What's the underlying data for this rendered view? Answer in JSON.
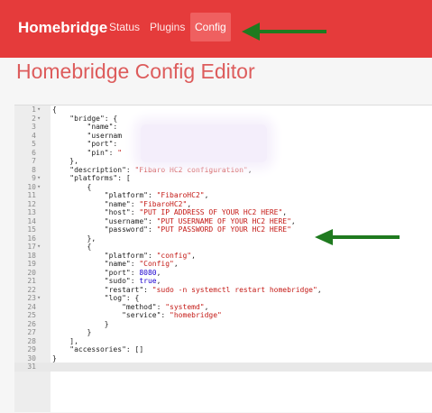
{
  "nav": {
    "brand": "Homebridge",
    "links": [
      "Status",
      "Plugins",
      "Config"
    ],
    "active": "Config"
  },
  "page": {
    "title": "Homebridge Config Editor"
  },
  "editor": {
    "lines": [
      {
        "n": "1",
        "fold": "▾",
        "t": [
          [
            "k",
            "{"
          ]
        ]
      },
      {
        "n": "2",
        "fold": "▾",
        "t": [
          [
            "k",
            "    \"bridge\": {"
          ]
        ]
      },
      {
        "n": "3",
        "fold": "",
        "t": [
          [
            "k",
            "        \"name\": "
          ]
        ]
      },
      {
        "n": "4",
        "fold": "",
        "t": [
          [
            "k",
            "        \"usernam"
          ]
        ]
      },
      {
        "n": "5",
        "fold": "",
        "t": [
          [
            "k",
            "        \"port\": "
          ]
        ]
      },
      {
        "n": "6",
        "fold": "",
        "t": [
          [
            "k",
            "        \"pin\": "
          ],
          [
            "s",
            "\""
          ]
        ]
      },
      {
        "n": "7",
        "fold": "",
        "t": [
          [
            "k",
            "    },"
          ]
        ]
      },
      {
        "n": "8",
        "fold": "",
        "t": [
          [
            "k",
            "    \"description\": "
          ],
          [
            "s",
            "\"Fibaro HC2 configuration\""
          ],
          [
            "k",
            ","
          ]
        ]
      },
      {
        "n": "9",
        "fold": "▾",
        "t": [
          [
            "k",
            "    \"platforms\": ["
          ]
        ]
      },
      {
        "n": "10",
        "fold": "▾",
        "t": [
          [
            "k",
            "        {"
          ]
        ]
      },
      {
        "n": "11",
        "fold": "",
        "t": [
          [
            "k",
            "            \"platform\": "
          ],
          [
            "s",
            "\"FibaroHC2\""
          ],
          [
            "k",
            ","
          ]
        ]
      },
      {
        "n": "12",
        "fold": "",
        "t": [
          [
            "k",
            "            \"name\": "
          ],
          [
            "s",
            "\"FibaroHC2\""
          ],
          [
            "k",
            ","
          ]
        ]
      },
      {
        "n": "13",
        "fold": "",
        "t": [
          [
            "k",
            "            \"host\": "
          ],
          [
            "s",
            "\"PUT IP ADDRESS OF YOUR HC2 HERE\""
          ],
          [
            "k",
            ","
          ]
        ]
      },
      {
        "n": "14",
        "fold": "",
        "t": [
          [
            "k",
            "            \"username\": "
          ],
          [
            "s",
            "\"PUT USERNAME OF YOUR HC2 HERE\""
          ],
          [
            "k",
            ","
          ]
        ]
      },
      {
        "n": "15",
        "fold": "",
        "t": [
          [
            "k",
            "            \"password\": "
          ],
          [
            "s",
            "\"PUT PASSWORD OF YOUR HC2 HERE\""
          ]
        ]
      },
      {
        "n": "16",
        "fold": "",
        "t": [
          [
            "k",
            "        },"
          ]
        ]
      },
      {
        "n": "17",
        "fold": "▾",
        "t": [
          [
            "k",
            "        {"
          ]
        ]
      },
      {
        "n": "18",
        "fold": "",
        "t": [
          [
            "k",
            "            \"platform\": "
          ],
          [
            "s",
            "\"config\""
          ],
          [
            "k",
            ","
          ]
        ]
      },
      {
        "n": "19",
        "fold": "",
        "t": [
          [
            "k",
            "            \"name\": "
          ],
          [
            "s",
            "\"Config\""
          ],
          [
            "k",
            ","
          ]
        ]
      },
      {
        "n": "20",
        "fold": "",
        "t": [
          [
            "k",
            "            \"port\": "
          ],
          [
            "n",
            "8080"
          ],
          [
            "k",
            ","
          ]
        ]
      },
      {
        "n": "21",
        "fold": "",
        "t": [
          [
            "k",
            "            \"sudo\": "
          ],
          [
            "n",
            "true"
          ],
          [
            "k",
            ","
          ]
        ]
      },
      {
        "n": "22",
        "fold": "",
        "t": [
          [
            "k",
            "            \"restart\": "
          ],
          [
            "s",
            "\"sudo -n systemctl restart homebridge\""
          ],
          [
            "k",
            ","
          ]
        ]
      },
      {
        "n": "23",
        "fold": "▾",
        "t": [
          [
            "k",
            "            \"log\": {"
          ]
        ]
      },
      {
        "n": "24",
        "fold": "",
        "t": [
          [
            "k",
            "                \"method\": "
          ],
          [
            "s",
            "\"systemd\""
          ],
          [
            "k",
            ","
          ]
        ]
      },
      {
        "n": "25",
        "fold": "",
        "t": [
          [
            "k",
            "                \"service\": "
          ],
          [
            "s",
            "\"homebridge\""
          ]
        ]
      },
      {
        "n": "26",
        "fold": "",
        "t": [
          [
            "k",
            "            }"
          ]
        ]
      },
      {
        "n": "27",
        "fold": "",
        "t": [
          [
            "k",
            "        }"
          ]
        ]
      },
      {
        "n": "28",
        "fold": "",
        "t": [
          [
            "k",
            "    ],"
          ]
        ]
      },
      {
        "n": "29",
        "fold": "",
        "t": [
          [
            "k",
            "    \"accessories\": []"
          ]
        ]
      },
      {
        "n": "30",
        "fold": "",
        "t": [
          [
            "k",
            "}"
          ]
        ]
      },
      {
        "n": "31",
        "fold": "",
        "t": [
          [
            "k",
            ""
          ]
        ]
      }
    ]
  },
  "colors": {
    "navbar": "#e53b3b",
    "title": "#dd5c5c",
    "arrow": "#1f7a1f",
    "string": "#c41a16",
    "number": "#1c00cf"
  }
}
